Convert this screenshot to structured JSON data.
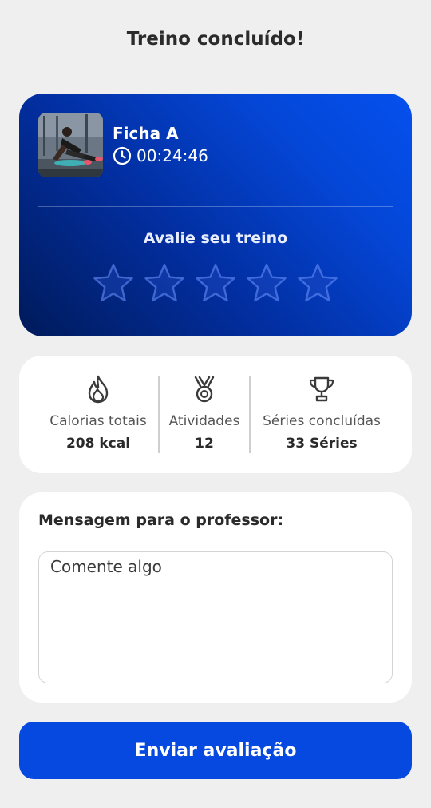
{
  "header": {
    "title": "Treino concluído!"
  },
  "summary": {
    "workout_name": "Ficha A",
    "duration": "00:24:46",
    "rate_label": "Avalie seu treino",
    "rating": {
      "value": 0,
      "max": 5
    },
    "colors": {
      "gradient_dark": "#001a5a",
      "gradient_light": "#0550ee"
    }
  },
  "stats": [
    {
      "icon": "flame-icon",
      "label": "Calorias totais",
      "value": "208 kcal"
    },
    {
      "icon": "medal-icon",
      "label": "Atividades",
      "value": "12"
    },
    {
      "icon": "trophy-icon",
      "label": "Séries concluídas",
      "value": "33 Séries"
    }
  ],
  "message": {
    "title": "Mensagem para o professor:",
    "placeholder": "Comente algo",
    "value": ""
  },
  "submit": {
    "label": "Enviar avaliação",
    "color": "#0549e0"
  }
}
